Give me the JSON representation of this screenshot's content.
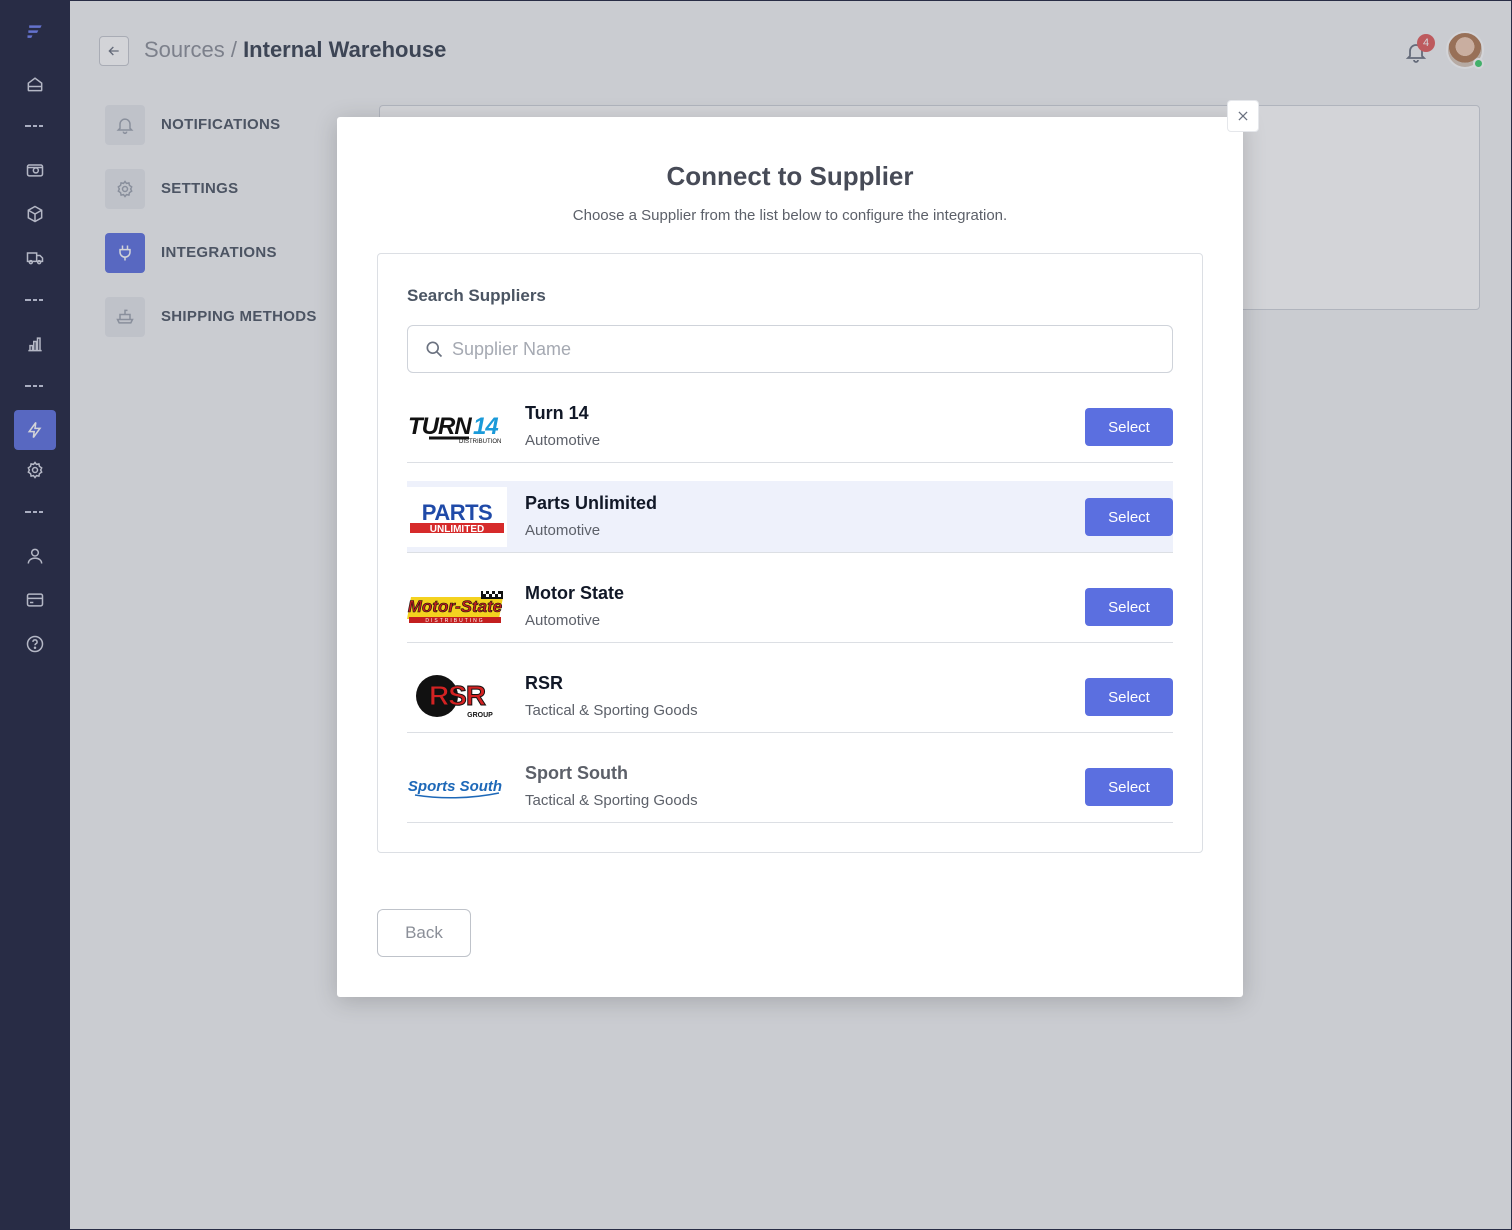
{
  "header": {
    "breadcrumb_parent": "Sources",
    "breadcrumb_sep": " / ",
    "breadcrumb_current": "Internal Warehouse",
    "notification_count": "4"
  },
  "nav": [
    {
      "label": "NOTIFICATIONS",
      "icon": "bell-icon"
    },
    {
      "label": "SETTINGS",
      "icon": "gear-icon"
    },
    {
      "label": "INTEGRATIONS",
      "icon": "plug-icon",
      "active": true
    },
    {
      "label": "SHIPPING METHODS",
      "icon": "ship-icon"
    }
  ],
  "modal": {
    "title": "Connect to Supplier",
    "subtitle": "Choose a Supplier from the list below to configure the integration.",
    "search_label": "Search Suppliers",
    "search_placeholder": "Supplier Name",
    "back_label": "Back",
    "select_label": "Select",
    "suppliers": [
      {
        "name": "Turn 14",
        "category": "Automotive",
        "logo_text": "TURN14",
        "logo_sub": "DISTRIBUTION"
      },
      {
        "name": "Parts Unlimited",
        "category": "Automotive",
        "logo_text": "PARTS",
        "logo_sub": "UNLIMITED"
      },
      {
        "name": "Motor State",
        "category": "Automotive",
        "logo_text": "Motor-State",
        "logo_sub": "DISTRIBUTING"
      },
      {
        "name": "RSR",
        "category": "Tactical & Sporting Goods",
        "logo_text": "RSR",
        "logo_sub": "GROUP"
      },
      {
        "name": "Sport South",
        "category": "Tactical & Sporting Goods",
        "logo_text": "Sports South",
        "logo_sub": ""
      }
    ]
  },
  "colors": {
    "sidebar": "#1b1f3b",
    "accent": "#5b6fe0",
    "badge": "#e25c5c",
    "online": "#3ecf6d"
  }
}
